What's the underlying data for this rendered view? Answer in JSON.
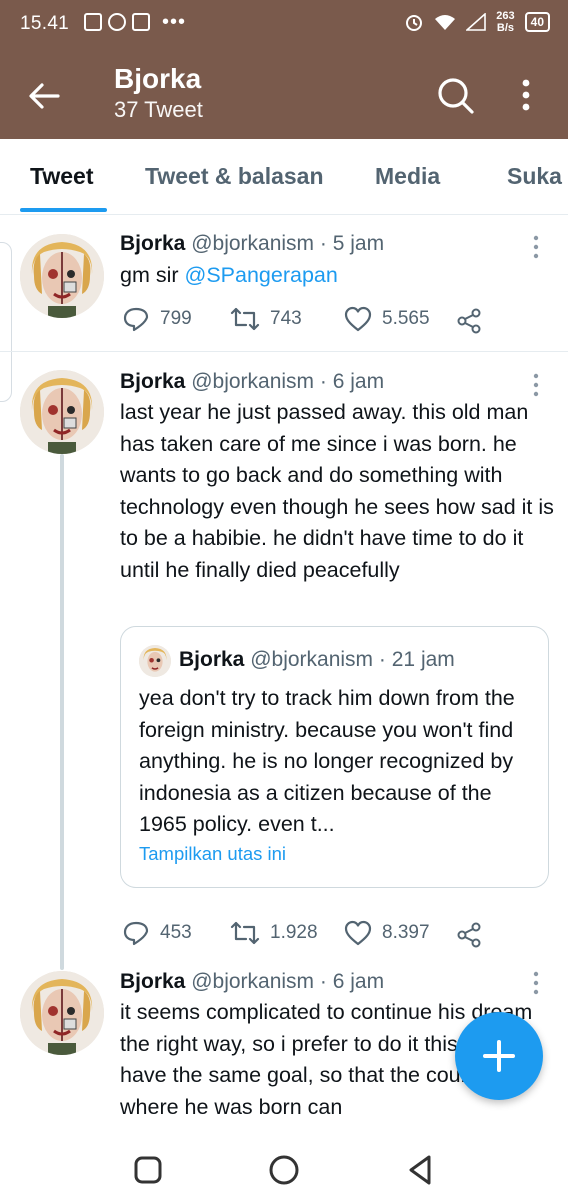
{
  "status_bar": {
    "time": "15.41",
    "net_speed_value": "263",
    "net_speed_unit": "B/s",
    "battery": "40",
    "icons": [
      "message-icon",
      "whatsapp-icon",
      "gallery-icon",
      "more-dots-icon",
      "alarm-icon",
      "wifi-icon",
      "signal-icon",
      "battery-icon"
    ]
  },
  "header": {
    "title": "Bjorka",
    "subtitle": "37 Tweet"
  },
  "tabs": [
    {
      "label": "Tweet",
      "active": true
    },
    {
      "label": "Tweet & balasan",
      "active": false
    },
    {
      "label": "Media",
      "active": false
    },
    {
      "label": "Suka",
      "active": false
    }
  ],
  "tweets": [
    {
      "name": "Bjorka",
      "handle": "@bjorkanism",
      "separator": "·",
      "time": "5 jam",
      "text_prefix": "gm sir ",
      "mention": "@SPangerapan",
      "replies": "799",
      "retweets": "743",
      "likes": "5.565"
    },
    {
      "name": "Bjorka",
      "handle": "@bjorkanism",
      "separator": "·",
      "time": "6 jam",
      "text": "last year he just passed away. this old man has taken care of me since i was born. he wants to go back and do something with technology even though he sees how sad it is to be a habibie. he didn't have time to do it until he finally died peacefully",
      "quote": {
        "name": "Bjorka",
        "handle": "@bjorkanism",
        "separator": "·",
        "time": "21 jam",
        "text": "yea don't try to track him down from the foreign ministry. because you won't find anything. he is no longer recognized by indonesia as a citizen because of the 1965 policy. even t...",
        "link": "Tampilkan utas ini"
      },
      "replies": "453",
      "retweets": "1.928",
      "likes": "8.397"
    },
    {
      "name": "Bjorka",
      "handle": "@bjorkanism",
      "separator": "·",
      "time": "6 jam",
      "text": "it seems complicated to continue his dream the right way, so i prefer to do it this way. we have the same goal, so that the country where he was born can"
    }
  ],
  "colors": {
    "header_bg": "#7a5a4c",
    "accent": "#1d9bf0",
    "secondary_text": "#536471",
    "divider": "#e6ecf0"
  }
}
